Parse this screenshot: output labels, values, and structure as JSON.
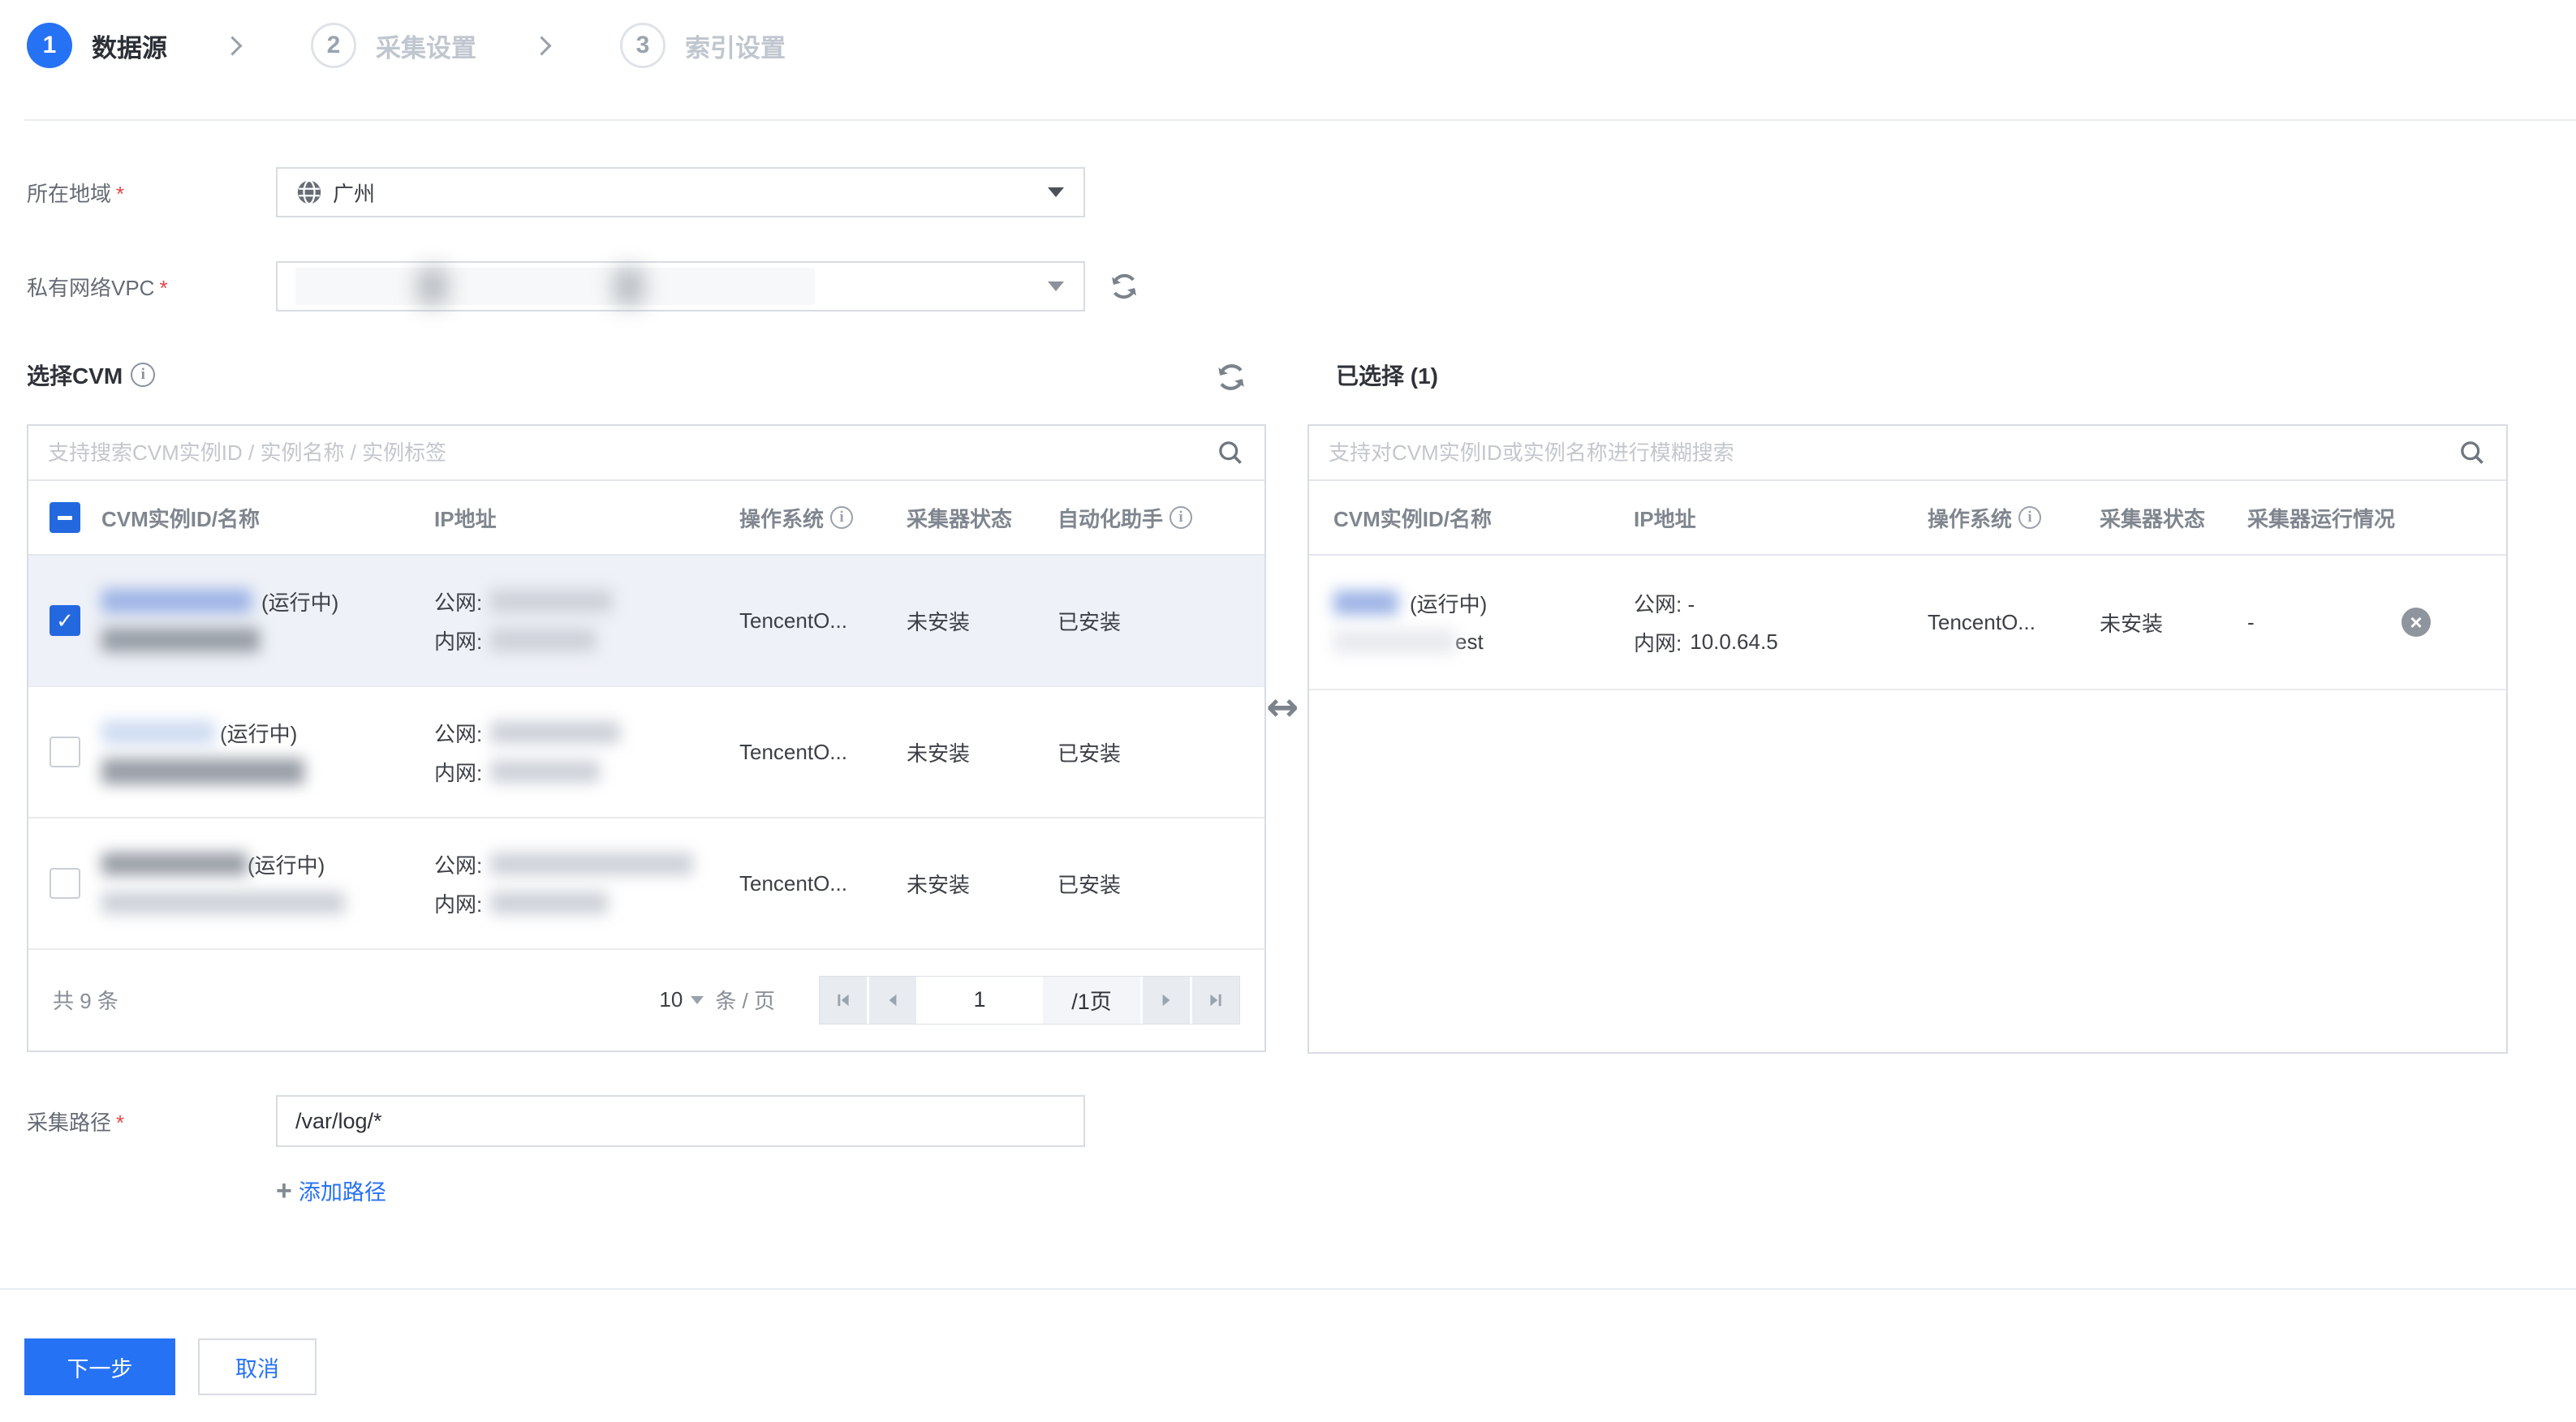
{
  "accent_color": "#2672f5",
  "checkbox_color": "#2468e0",
  "selected_row_color": "#eef1f7",
  "stepper": {
    "steps": [
      {
        "number": "1",
        "label": "数据源",
        "state": "active"
      },
      {
        "number": "2",
        "label": "采集设置",
        "state": "inactive"
      },
      {
        "number": "3",
        "label": "索引设置",
        "state": "inactive"
      }
    ]
  },
  "form": {
    "region": {
      "label": "所在地域",
      "required": "*",
      "value": "广州"
    },
    "vpc": {
      "label": "私有网络VPC",
      "required": "*"
    },
    "path": {
      "label": "采集路径",
      "required": "*",
      "value": "/var/log/*",
      "add_link": "添加路径"
    }
  },
  "left_panel": {
    "title": "选择CVM",
    "search_placeholder": "支持搜索CVM实例ID / 实例名称 / 实例标签",
    "columns": {
      "id": "CVM实例ID/名称",
      "ip": "IP地址",
      "os": "操作系统",
      "collector": "采集器状态",
      "assistant": "自动化助手"
    },
    "rows": [
      {
        "running": "(运行中)",
        "public_label": "公网:",
        "private_label": "内网:",
        "os": "TencentO...",
        "collector": "未安装",
        "assistant": "已安装"
      },
      {
        "running": "(运行中)",
        "public_label": "公网:",
        "private_label": "内网:",
        "os": "TencentO...",
        "collector": "未安装",
        "assistant": "已安装"
      },
      {
        "running": "(运行中)",
        "public_label": "公网:",
        "private_label": "内网:",
        "os": "TencentO...",
        "collector": "未安装",
        "assistant": "已安装"
      }
    ],
    "pagination": {
      "total": "共 9 条",
      "page_size": "10",
      "unit": "条 / 页",
      "current_page": "1",
      "total_pages": "/1页"
    }
  },
  "right_panel": {
    "title": "已选择 (1)",
    "search_placeholder": "支持对CVM实例ID或实例名称进行模糊搜索",
    "columns": {
      "id": "CVM实例ID/名称",
      "ip": "IP地址",
      "os": "操作系统",
      "collector": "采集器状态",
      "run": "采集器运行情况"
    },
    "rows": [
      {
        "running": "(运行中)",
        "name_suffix": "est",
        "public": "公网: -",
        "private_label": "内网:",
        "private_ip": "10.0.64.5",
        "os": "TencentO...",
        "collector": "未安装",
        "run_status": "-"
      }
    ]
  },
  "footer": {
    "next": "下一步",
    "cancel": "取消"
  }
}
